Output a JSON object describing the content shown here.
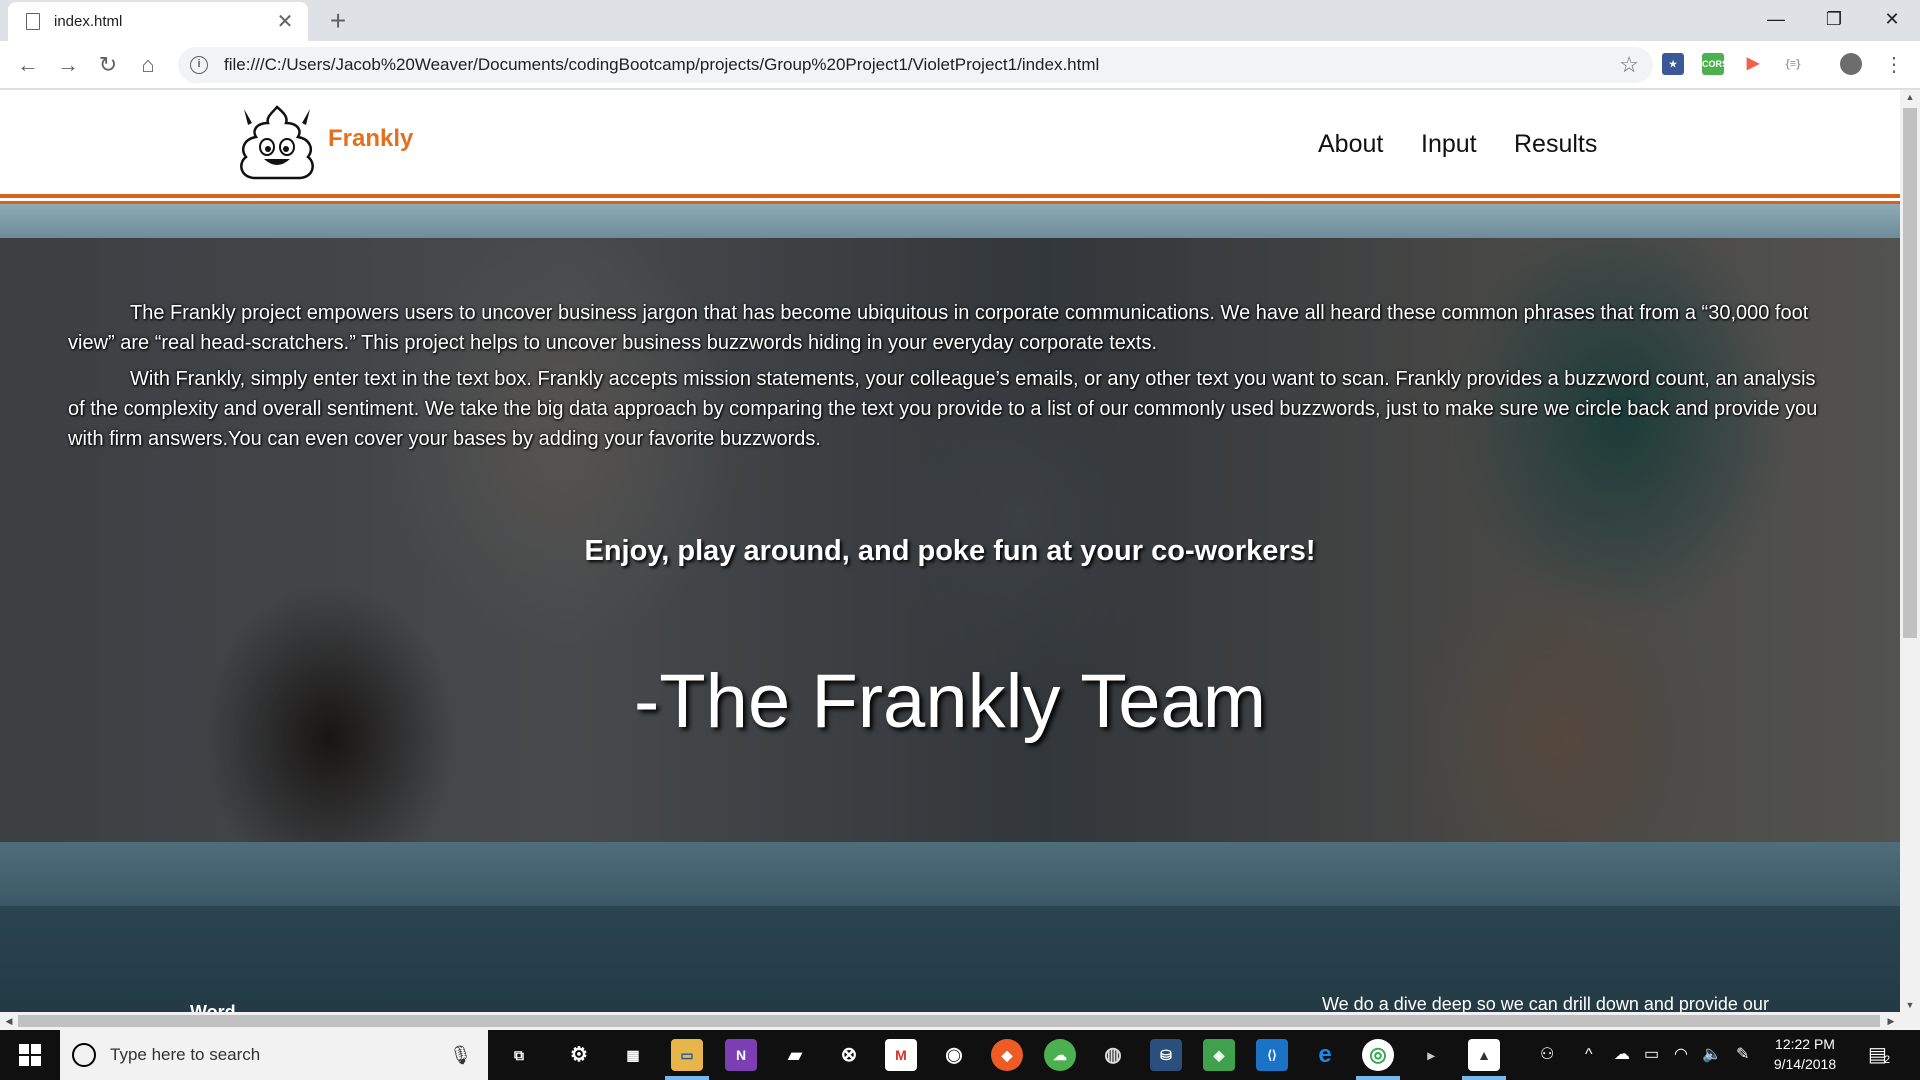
{
  "browser": {
    "tab_title": "index.html",
    "tab_close": "✕",
    "new_tab": "+",
    "url": "file:///C:/Users/Jacob%20Weaver/Documents/codingBootcamp/projects/Group%20Project1/VioletProject1/index.html",
    "window_minimize": "—",
    "window_restore": "❐",
    "window_close": "✕",
    "extensions": [
      {
        "icon": "bookmark-star-extension-icon",
        "label": "★",
        "color": "#3b5998"
      },
      {
        "icon": "cors-extension-icon",
        "label": "CORS",
        "color": "#4caf50"
      },
      {
        "icon": "cast-extension-icon",
        "label": "▶",
        "color": "#f0604f"
      },
      {
        "icon": "json-extension-icon",
        "label": "{≡}",
        "color": "#9e9e9e"
      }
    ]
  },
  "site": {
    "brand": "Frankly",
    "nav": [
      "About",
      "Input",
      "Results"
    ],
    "hero": {
      "paragraphs": [
        "The Frankly project empowers users to uncover business jargon that has become ubiquitous in corporate communications. We have all heard these common phrases that from a “30,000 foot view” are “real head-scratchers.” This project helps to uncover business buzzwords hiding in your everyday corporate texts.",
        "With Frankly, simply enter text in the text box. Frankly accepts mission statements, your colleague’s emails, or any other text you want to scan. Frankly provides a buzzword count, an analysis of the complexity and overall sentiment. We take the big data approach by comparing the text you provide to a list of our commonly used buzzwords, just to make sure we circle back and provide you with firm answers.You can even cover your bases by adding your favorite buzzwords."
      ],
      "tagline": "Enjoy, play around, and poke fun at your co-workers!",
      "signature": "-The Frankly Team"
    },
    "lower": {
      "word_heading": "Word",
      "dive_text": "We do a dive deep so we can drill down and provide our"
    }
  },
  "taskbar": {
    "search_placeholder": "Type here to search",
    "apps": [
      {
        "icon": "task-view-icon",
        "glyph": "⧉",
        "color": "transparent"
      },
      {
        "icon": "settings-gear-icon",
        "glyph": "⚙",
        "color": "transparent"
      },
      {
        "icon": "store-icon",
        "glyph": "🛍",
        "color": "transparent"
      },
      {
        "icon": "file-explorer-icon",
        "glyph": "📁",
        "color": "#e8b54a"
      },
      {
        "icon": "onenote-icon",
        "glyph": "N",
        "color": "#7b3eb3"
      },
      {
        "icon": "sticky-notes-icon",
        "glyph": "▰",
        "color": "transparent"
      },
      {
        "icon": "xbox-icon",
        "glyph": "⊗",
        "color": "transparent"
      },
      {
        "icon": "gmail-icon",
        "glyph": "M",
        "color": "#d93025"
      },
      {
        "icon": "github-icon",
        "glyph": "◉",
        "color": "transparent"
      },
      {
        "icon": "postman-icon",
        "glyph": "◆",
        "color": "#ef5b25"
      },
      {
        "icon": "chat-icon",
        "glyph": "☁",
        "color": "#4caf50"
      },
      {
        "icon": "github-desktop-icon",
        "glyph": "◍",
        "color": "transparent"
      },
      {
        "icon": "mysql-workbench-icon",
        "glyph": "⛁",
        "color": "#2b4f7d"
      },
      {
        "icon": "git-kraken-icon",
        "glyph": "◈",
        "color": "#3fa14e"
      },
      {
        "icon": "vscode-icon",
        "glyph": "⟨⟩",
        "color": "#1a73c7"
      },
      {
        "icon": "edge-icon",
        "glyph": "e",
        "color": "#1e88e5"
      },
      {
        "icon": "chrome-icon",
        "glyph": "◎",
        "color": "#34a853"
      },
      {
        "icon": "terminal-icon",
        "glyph": "▸",
        "color": "transparent"
      },
      {
        "icon": "photos-icon",
        "glyph": "▲",
        "color": "transparent"
      }
    ],
    "time": "12:22 PM",
    "date": "9/14/2018",
    "notification_count": "2"
  }
}
